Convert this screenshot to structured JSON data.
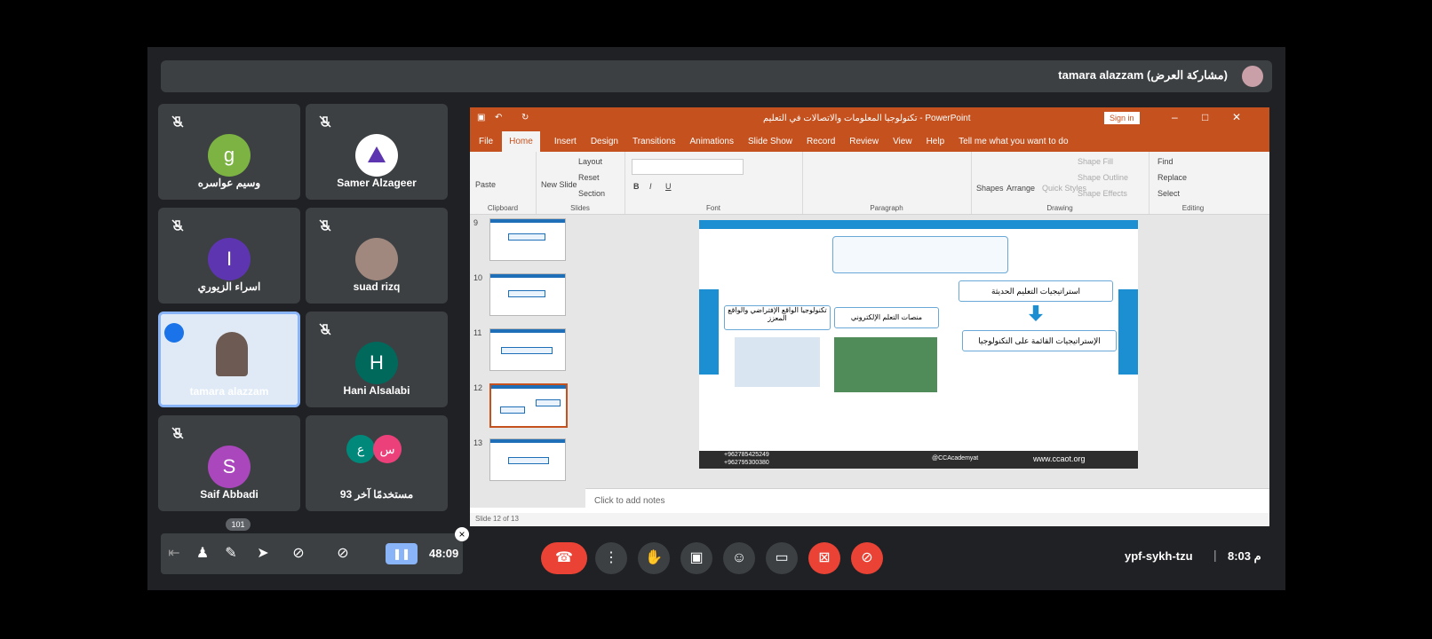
{
  "presenter": {
    "label": "tamara alazzam (مشاركة العرض)"
  },
  "participants": [
    {
      "name": "وسيم عواسره",
      "initial": "g",
      "color": "#7cb342"
    },
    {
      "name": "Samer Alzageer",
      "initial": "",
      "color": "#ffffff"
    },
    {
      "name": "اسراء الزيوري",
      "initial": "I",
      "color": "#5e35b1"
    },
    {
      "name": "suad rizq",
      "initial": "",
      "color": "#a1887f"
    },
    {
      "name": "tamara alazzam",
      "initial": "",
      "color": "#e8f0fe"
    },
    {
      "name": "Hani Alsalabi",
      "initial": "H",
      "color": "#00695c"
    },
    {
      "name": "Saif Abbadi",
      "initial": "S",
      "color": "#ab47bc"
    },
    {
      "name": "93 مستخدمًا آخر",
      "initial": "ع",
      "color": "#00897b"
    }
  ],
  "others_badge": "س",
  "ppt": {
    "title": "تكنولوجيا المعلومات والاتصالات في التعليم - PowerPoint",
    "signin": "Sign in",
    "tabs": [
      "File",
      "Home",
      "Insert",
      "Design",
      "Transitions",
      "Animations",
      "Slide Show",
      "Record",
      "Review",
      "View",
      "Help",
      "Tell me what you want to do"
    ],
    "groups": [
      "Clipboard",
      "Slides",
      "Font",
      "Paragraph",
      "Drawing",
      "Editing"
    ],
    "ribbon_items": {
      "paste": "Paste",
      "new_slide": "New Slide",
      "layout": "Layout",
      "reset": "Reset",
      "section": "Section",
      "shapes": "Shapes",
      "arrange": "Arrange",
      "quick_styles": "Quick Styles",
      "shape_fill": "Shape Fill",
      "shape_outline": "Shape Outline",
      "shape_effects": "Shape Effects",
      "find": "Find",
      "replace": "Replace",
      "select": "Select"
    },
    "thumbs": [
      "9",
      "10",
      "11",
      "12",
      "13"
    ],
    "notes_placeholder": "Click to add notes",
    "status": "Slide 12 of 13",
    "slide": {
      "heading1": "استراتيجيات التعليم الحديثة",
      "heading2": "الإستراتيجيات القائمة على التكنولوجيا",
      "box_a": "تكنولوجيا الواقع الإفتراضي والواقع المعزز",
      "box_b": "منصات التعلم الإلكتروني",
      "social": "@CCAcademyat",
      "website": "www.ccaot.org",
      "phone1": "+962785425249",
      "phone2": "+962795300380"
    }
  },
  "controls": {
    "timer": "48:09",
    "viewers": "101",
    "meeting_code": "ypf-sykh-tzu",
    "clock": "8:03 م"
  }
}
